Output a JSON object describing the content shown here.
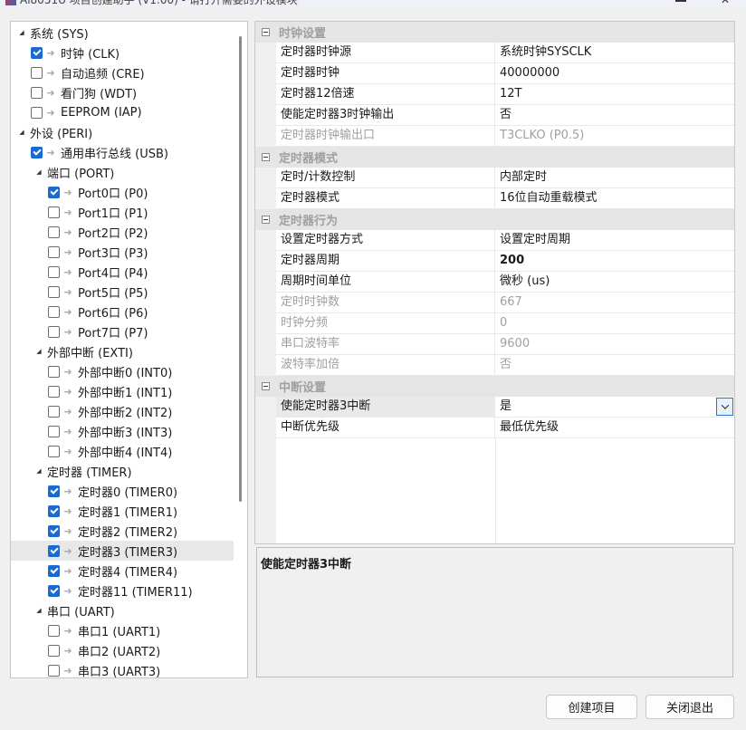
{
  "window": {
    "title": "Ai8051U 项目创建助手 (V1.00) - 请打开需要的外设模块",
    "close_glyph": "✕"
  },
  "tree": {
    "items": [
      {
        "label": "系统 (SYS)",
        "level": 0,
        "type": "group",
        "expanded": true
      },
      {
        "label": "时钟 (CLK)",
        "level": 1,
        "type": "item",
        "checked": true
      },
      {
        "label": "自动追频 (CRE)",
        "level": 1,
        "type": "item",
        "checked": false
      },
      {
        "label": "看门狗 (WDT)",
        "level": 1,
        "type": "item",
        "checked": false
      },
      {
        "label": "EEPROM (IAP)",
        "level": 1,
        "type": "item",
        "checked": false
      },
      {
        "label": "外设 (PERI)",
        "level": 0,
        "type": "group",
        "expanded": true
      },
      {
        "label": "通用串行总线 (USB)",
        "level": 1,
        "type": "item",
        "checked": true
      },
      {
        "label": "端口 (PORT)",
        "level": 1,
        "type": "group",
        "expanded": true
      },
      {
        "label": "Port0口 (P0)",
        "level": 2,
        "type": "item",
        "checked": true
      },
      {
        "label": "Port1口 (P1)",
        "level": 2,
        "type": "item",
        "checked": false
      },
      {
        "label": "Port2口 (P2)",
        "level": 2,
        "type": "item",
        "checked": false
      },
      {
        "label": "Port3口 (P3)",
        "level": 2,
        "type": "item",
        "checked": false
      },
      {
        "label": "Port4口 (P4)",
        "level": 2,
        "type": "item",
        "checked": false
      },
      {
        "label": "Port5口 (P5)",
        "level": 2,
        "type": "item",
        "checked": false
      },
      {
        "label": "Port6口 (P6)",
        "level": 2,
        "type": "item",
        "checked": false
      },
      {
        "label": "Port7口 (P7)",
        "level": 2,
        "type": "item",
        "checked": false
      },
      {
        "label": "外部中断 (EXTI)",
        "level": 1,
        "type": "group",
        "expanded": true
      },
      {
        "label": "外部中断0 (INT0)",
        "level": 2,
        "type": "item",
        "checked": false
      },
      {
        "label": "外部中断1 (INT1)",
        "level": 2,
        "type": "item",
        "checked": false
      },
      {
        "label": "外部中断2 (INT2)",
        "level": 2,
        "type": "item",
        "checked": false
      },
      {
        "label": "外部中断3 (INT3)",
        "level": 2,
        "type": "item",
        "checked": false
      },
      {
        "label": "外部中断4 (INT4)",
        "level": 2,
        "type": "item",
        "checked": false
      },
      {
        "label": "定时器 (TIMER)",
        "level": 1,
        "type": "group",
        "expanded": true
      },
      {
        "label": "定时器0 (TIMER0)",
        "level": 2,
        "type": "item",
        "checked": true
      },
      {
        "label": "定时器1 (TIMER1)",
        "level": 2,
        "type": "item",
        "checked": true
      },
      {
        "label": "定时器2 (TIMER2)",
        "level": 2,
        "type": "item",
        "checked": true
      },
      {
        "label": "定时器3 (TIMER3)",
        "level": 2,
        "type": "item",
        "checked": true,
        "selected": true
      },
      {
        "label": "定时器4 (TIMER4)",
        "level": 2,
        "type": "item",
        "checked": true
      },
      {
        "label": "定时器11 (TIMER11)",
        "level": 2,
        "type": "item",
        "checked": true
      },
      {
        "label": "串口 (UART)",
        "level": 1,
        "type": "group",
        "expanded": true
      },
      {
        "label": "串口1 (UART1)",
        "level": 2,
        "type": "item",
        "checked": false
      },
      {
        "label": "串口2 (UART2)",
        "level": 2,
        "type": "item",
        "checked": false
      },
      {
        "label": "串口3 (UART3)",
        "level": 2,
        "type": "item",
        "checked": false
      }
    ]
  },
  "properties": {
    "categories": [
      {
        "label": "时钟设置",
        "rows": [
          {
            "name": "定时器时钟源",
            "value": "系统时钟SYSCLK"
          },
          {
            "name": "定时器时钟",
            "value": "40000000"
          },
          {
            "name": "定时器12倍速",
            "value": "12T"
          },
          {
            "name": "使能定时器3时钟输出",
            "value": "否"
          },
          {
            "name": "定时器时钟输出口",
            "value": "T3CLKO (P0.5)",
            "disabled": true
          }
        ]
      },
      {
        "label": "定时器模式",
        "rows": [
          {
            "name": "定时/计数控制",
            "value": "内部定时"
          },
          {
            "name": "定时器模式",
            "value": "16位自动重载模式"
          }
        ]
      },
      {
        "label": "定时器行为",
        "rows": [
          {
            "name": "设置定时器方式",
            "value": "设置定时周期"
          },
          {
            "name": "定时器周期",
            "value": "200",
            "bold": true
          },
          {
            "name": "周期时间单位",
            "value": "微秒 (us)"
          },
          {
            "name": "定时时钟数",
            "value": "667",
            "disabled": true
          },
          {
            "name": "时钟分频",
            "value": "0",
            "disabled": true
          },
          {
            "name": "串口波特率",
            "value": "9600",
            "disabled": true
          },
          {
            "name": "波特率加倍",
            "value": "否",
            "disabled": true
          }
        ]
      },
      {
        "label": "中断设置",
        "rows": [
          {
            "name": "使能定时器3中断",
            "value": "是",
            "selected": true,
            "dropdown": true
          },
          {
            "name": "中断优先级",
            "value": "最低优先级"
          }
        ]
      }
    ]
  },
  "description": {
    "title": "使能定时器3中断"
  },
  "buttons": {
    "create_label": "创建项目",
    "close_label": "关闭退出"
  },
  "colors": {
    "accent": "#1a6bd1",
    "category_bg": "#e5e5e5",
    "disabled_text": "#a0a0a0"
  }
}
